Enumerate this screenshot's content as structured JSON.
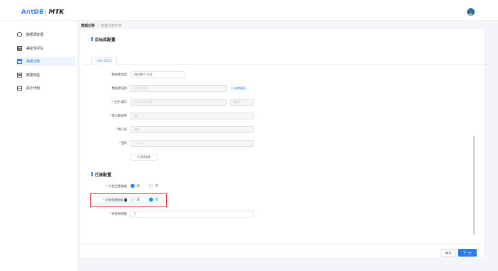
{
  "header": {
    "logo": "AntDB",
    "product": "MTK"
  },
  "sidebar": {
    "items": [
      {
        "label": "数据源管理",
        "icon": "database-icon"
      },
      {
        "label": "兼容性评估",
        "icon": "report-icon"
      },
      {
        "label": "数据迁移",
        "icon": "folder-icon",
        "active": true
      },
      {
        "label": "数据校验",
        "icon": "check-icon"
      },
      {
        "label": "执行计划",
        "icon": "calendar-icon"
      }
    ]
  },
  "breadcrumb": {
    "parent": "数据迁移",
    "separator": "/",
    "current": "新建迁移任务"
  },
  "target_section": {
    "title": "目标库配置",
    "tab": "149_3333",
    "fields": {
      "db_type": {
        "label": "数据库类型",
        "value": "AntDB-T / 6.0"
      },
      "datasource_name": {
        "label": "数据源名称",
        "value": "149_3333",
        "link": "已有数据源"
      },
      "host_port": {
        "label": "主机:端口",
        "host": "10.21.10.149",
        "port": "3333"
      },
      "default_db": {
        "label": "默认数据库",
        "value": "tgt"
      },
      "username": {
        "label": "用户名",
        "value": "tgt1"
      },
      "password": {
        "label": "密码",
        "value": "••••••"
      },
      "test_button": "测试连接"
    }
  },
  "migration_section": {
    "title": "迁移配置",
    "full_data": {
      "label": "迁移全量数据",
      "yes": "是",
      "no": "否",
      "selected": "是"
    },
    "incremental_data": {
      "label": "迁移增量数据",
      "yes": "是",
      "no": "否",
      "selected": "否"
    },
    "parallel": {
      "label": "并发线程数",
      "value": "1"
    }
  },
  "footer": {
    "cancel": "取消",
    "next": "下一步"
  },
  "colors": {
    "accent": "#2b7be8",
    "highlight": "#e0242d"
  }
}
